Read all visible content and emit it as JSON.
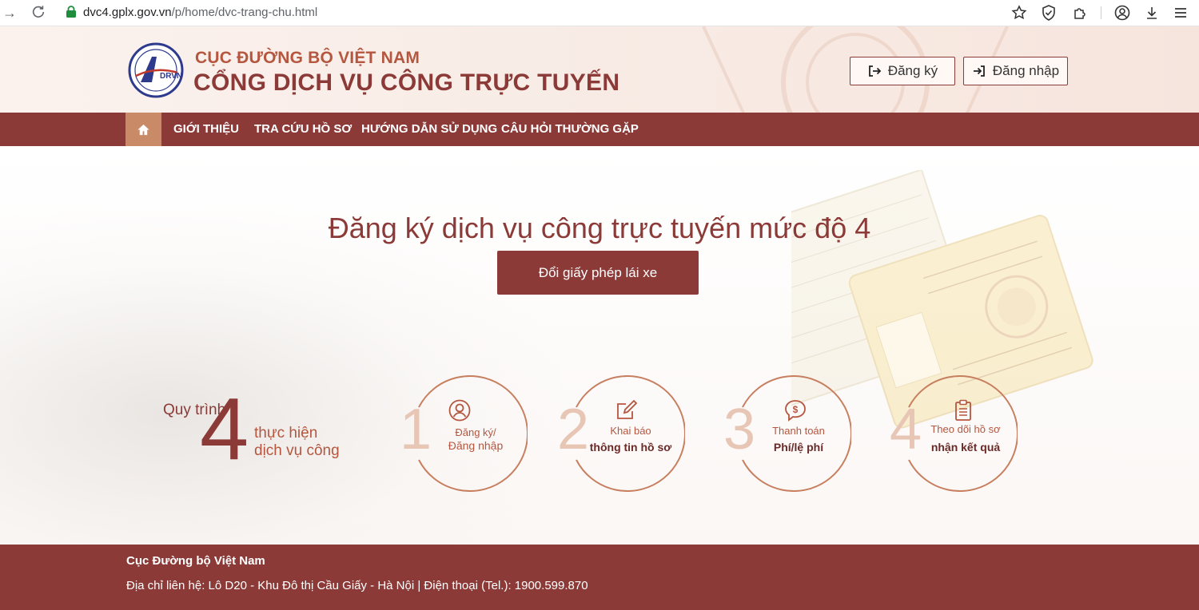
{
  "browser": {
    "url_host": "dvc4.gplx.gov.vn",
    "url_path": "/p/home/dvc-trang-chu.html"
  },
  "header": {
    "logo_text": "DRVN",
    "org_name": "CỤC ĐƯỜNG BỘ VIỆT NAM",
    "portal_name": "CỔNG DỊCH VỤ CÔNG TRỰC TUYẾN",
    "register_label": "Đăng ký",
    "login_label": "Đăng nhập"
  },
  "nav": {
    "items": [
      {
        "label": "GIỚI THIỆU"
      },
      {
        "label": "TRA CỨU HỒ SƠ"
      },
      {
        "label": "HƯỚNG DẪN SỬ DỤNG"
      },
      {
        "label": "CÂU HỎI THƯỜNG GẶP"
      }
    ]
  },
  "hero": {
    "title": "Đăng ký dịch vụ công trực tuyến mức độ 4",
    "cta_label": "Đổi giấy phép lái xe"
  },
  "process": {
    "label_top": "Quy trình",
    "big_number": "4",
    "label_line1": "thực hiện",
    "label_line2": "dịch vụ công",
    "steps": [
      {
        "num": "1",
        "line1": "Đăng ký/",
        "line2": "Đăng nhập",
        "icon": "user-icon"
      },
      {
        "num": "2",
        "line1": "Khai báo",
        "line2": "thông tin hồ sơ",
        "icon": "edit-icon"
      },
      {
        "num": "3",
        "line1": "Thanh toán",
        "line2": "Phí/lệ phí",
        "icon": "payment-icon"
      },
      {
        "num": "4",
        "line1": "Theo dõi hồ sơ",
        "line2": "nhận kết quả",
        "icon": "clipboard-icon"
      }
    ]
  },
  "footer": {
    "org": "Cục Đường bộ Việt Nam",
    "contact": "Địa chỉ liên hệ: Lô D20 - Khu Đô thị Cầu Giấy - Hà Nội | Điện thoại (Tel.): 1900.599.870"
  },
  "colors": {
    "brand": "#8b3a37",
    "accent": "#b5563f",
    "nav_home": "#c98a67"
  }
}
